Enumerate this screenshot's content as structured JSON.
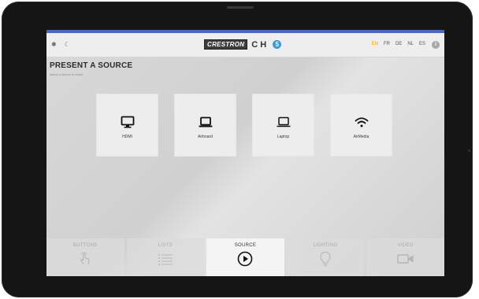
{
  "header": {
    "nav_icons": [
      "star-icon",
      "moon-icon"
    ],
    "brand_logo": "CRESTRON",
    "brand_ch": "CH",
    "brand_number": "5",
    "languages": [
      "EN",
      "FR",
      "DE",
      "NL",
      "ES"
    ],
    "active_language": "EN",
    "info_label": "i",
    "accent_color": "#4a66c9"
  },
  "page": {
    "title": "PRESENT A SOURCE",
    "subtitle": "select a source to share"
  },
  "sources": [
    {
      "label": "HDMI",
      "icon": "monitor-icon"
    },
    {
      "label": "Airboard",
      "icon": "laptop-icon"
    },
    {
      "label": "Laptop",
      "icon": "laptop-icon"
    },
    {
      "label": "AirMedia",
      "icon": "wifi-icon"
    }
  ],
  "bottom_nav": [
    {
      "label": "BUTTONS",
      "icon": "touch-icon",
      "active": false
    },
    {
      "label": "LISTS",
      "icon": "list-icon",
      "active": false
    },
    {
      "label": "SOURCE",
      "icon": "play-icon",
      "active": true
    },
    {
      "label": "LIGHTING",
      "icon": "bulb-icon",
      "active": false
    },
    {
      "label": "VIDEO",
      "icon": "video-camera-icon",
      "active": false
    }
  ]
}
